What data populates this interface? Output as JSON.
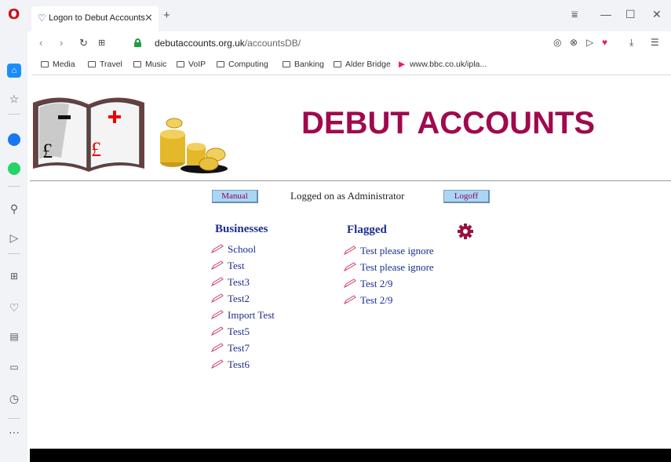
{
  "browser": {
    "tab_title": "Logon to Debut Accounts",
    "url_domain": "debutaccounts.org.uk",
    "url_path": "/accountsDB/",
    "bookmarks": [
      {
        "label": "Media"
      },
      {
        "label": "Travel"
      },
      {
        "label": "Music"
      },
      {
        "label": "VoIP"
      },
      {
        "label": "Computing"
      },
      {
        "label": "Banking"
      },
      {
        "label": "Alder Bridge"
      },
      {
        "label": "www.bbc.co.uk/ipla..."
      }
    ]
  },
  "header": {
    "site_title": "DEBUT ACCOUNTS",
    "title_color": "#a0094e"
  },
  "toolbar": {
    "manual_label": "Manual",
    "status_text": "Logged on as Administrator",
    "logoff_label": "Logoff"
  },
  "businesses": {
    "title": "Businesses",
    "items": [
      {
        "label": "School"
      },
      {
        "label": "Test"
      },
      {
        "label": "Test3"
      },
      {
        "label": "Test2"
      },
      {
        "label": "Import Test"
      },
      {
        "label": "Test5"
      },
      {
        "label": "Test7"
      },
      {
        "label": "Test6"
      }
    ]
  },
  "flagged": {
    "title": "Flagged",
    "items": [
      {
        "label": "Test please ignore"
      },
      {
        "label": "Test please ignore"
      },
      {
        "label": "Test 2/9"
      },
      {
        "label": "Test 2/9"
      }
    ]
  },
  "icons": {
    "list_item_icon": "pencil-icon",
    "settings_icon": "gear-icon"
  }
}
